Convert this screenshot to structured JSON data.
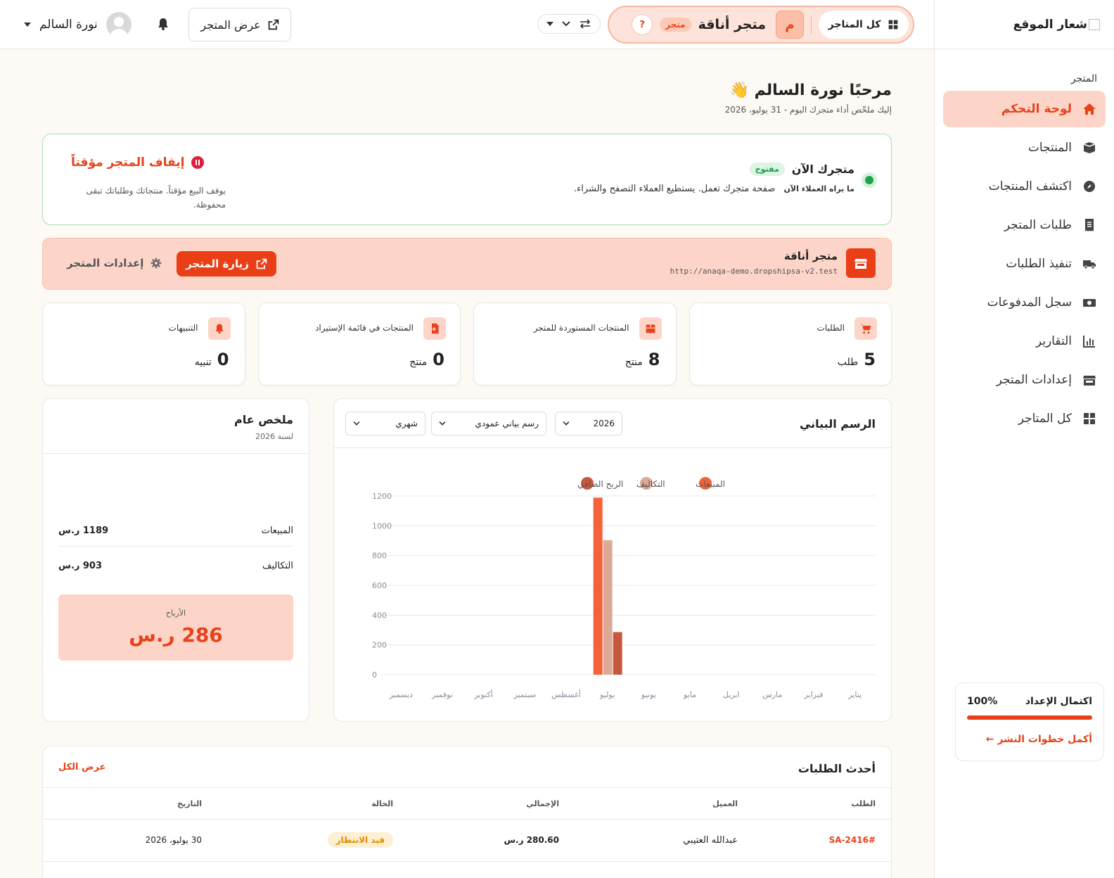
{
  "sidebar": {
    "logo_text": "شعار الموقع",
    "section_label": "المتجر",
    "items": [
      {
        "label": "لوحة التحكم",
        "icon": "home-icon"
      },
      {
        "label": "المنتجات",
        "icon": "box-icon"
      },
      {
        "label": "اكتشف المنتجات",
        "icon": "compass-icon"
      },
      {
        "label": "طلبات المتجر",
        "icon": "receipt-icon"
      },
      {
        "label": "تنفيذ الطلبات",
        "icon": "truck-icon"
      },
      {
        "label": "سجل المدفوعات",
        "icon": "money-icon"
      },
      {
        "label": "التقارير",
        "icon": "chart-icon"
      },
      {
        "label": "إعدادات المتجر",
        "icon": "store-icon"
      },
      {
        "label": "كل المتاجر",
        "icon": "grid-icon"
      }
    ],
    "setup": {
      "title": "اكتمال الإعداد",
      "percent_text": "100%",
      "progress": 1.0,
      "link": "أكمل خطوات النشر ←"
    }
  },
  "topbar": {
    "all_stores": "كل المتاجر",
    "store_initial": "م",
    "store_name": "متجر أناقة",
    "store_tag": "متجر",
    "help": "?",
    "view_store": "عرض المتجر",
    "user_name": "نورة السالم"
  },
  "welcome": {
    "title": "مرحبًا نورة السالم 👋",
    "subtitle": "إليك ملخّص أداء متجرك اليوم - 31 يوليو، 2026"
  },
  "status": {
    "title": "متجرك الآن",
    "badge": "مفتوح",
    "desc_bold": "ما يراه العملاء الآن",
    "desc": "صفحة متجرك تعمل. يستطيع العملاء التصفح والشراء.",
    "pause_title": "إيقاف المتجر مؤقتاً",
    "pause_desc": "يوقف البيع مؤقتاً. منتجاتك وطلباتك تبقى محفوظة."
  },
  "banner": {
    "name": "متجر أناقة",
    "url": "http://anaqa-demo.dropshipsa-v2.test",
    "visit": "زيارة المتجر",
    "settings": "إعدادات المتجر"
  },
  "stats": [
    {
      "label": "الطلبات",
      "value": "5",
      "unit": "طلب",
      "icon": "cart-icon"
    },
    {
      "label": "المنتجات المستوردة للمتجر",
      "value": "8",
      "unit": "منتج",
      "icon": "box-icon"
    },
    {
      "label": "المنتجات في قائمة الإستيراد",
      "value": "0",
      "unit": "منتج",
      "icon": "import-icon"
    },
    {
      "label": "التنبيهات",
      "value": "0",
      "unit": "تنبيه",
      "icon": "bell-icon"
    }
  ],
  "summary": {
    "title": "ملخص عام",
    "subtitle": "لسنة 2026",
    "sales_label": "المبيعات",
    "sales_value": "1189 ر.س",
    "costs_label": "التكاليف",
    "costs_value": "903 ر.س",
    "profit_label": "الأرباح",
    "profit_value": "286 ر.س"
  },
  "chart_panel": {
    "title": "الرسم البياني",
    "year_select": "2026",
    "type_select": "رسم بياني عمودي",
    "period_select": "شهري"
  },
  "chart_data": {
    "type": "bar",
    "categories": [
      "يناير",
      "فبراير",
      "مارس",
      "ابريل",
      "مايو",
      "يونيو",
      "يوليو",
      "أغسطس",
      "سبتمبر",
      "أكتوبر",
      "نوفمبر",
      "ديسمبر"
    ],
    "series": [
      {
        "name": "المبيعات",
        "color": "#f4623a",
        "values": [
          0,
          0,
          0,
          0,
          0,
          0,
          1189,
          0,
          0,
          0,
          0,
          0
        ]
      },
      {
        "name": "التكاليف",
        "color": "#dba995",
        "values": [
          0,
          0,
          0,
          0,
          0,
          0,
          903,
          0,
          0,
          0,
          0,
          0
        ]
      },
      {
        "name": "الربح الصافي",
        "color": "#c8583d",
        "values": [
          0,
          0,
          0,
          0,
          0,
          0,
          286,
          0,
          0,
          0,
          0,
          0
        ]
      }
    ],
    "yticks": [
      0,
      200,
      400,
      600,
      800,
      1000,
      1200
    ],
    "ylim": [
      0,
      1200
    ],
    "grid": true,
    "legend_position": "top-center"
  },
  "orders": {
    "title": "أحدث الطلبات",
    "view_all": "عرض الكل",
    "columns": [
      "الطلب",
      "العميل",
      "الإجمالي",
      "الحالة",
      "التاريخ"
    ],
    "rows": [
      {
        "id": "SA-2416#",
        "customer": "عبدالله العتيبي",
        "total": "280.60 ر.س",
        "status": "قيد الانتظار",
        "date": "30 يوليو، 2026"
      }
    ]
  },
  "colors": {
    "accent": "#ea3e17",
    "accent_soft": "#fdd5c8",
    "success": "#1ea54c"
  }
}
